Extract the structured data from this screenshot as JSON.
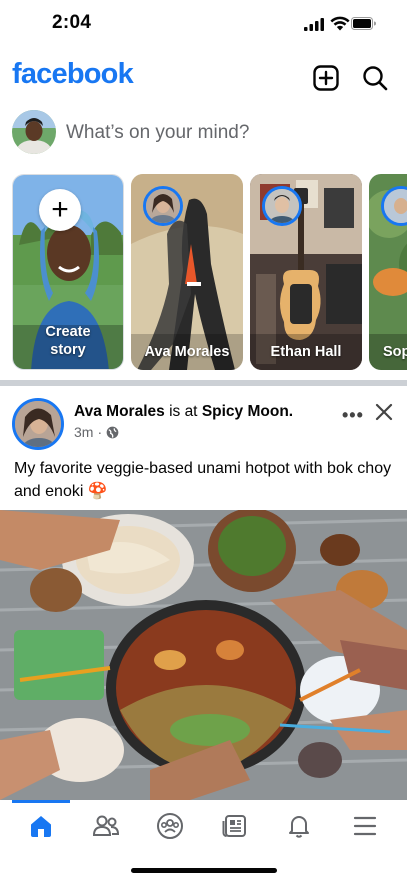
{
  "status": {
    "time": "2:04"
  },
  "header": {
    "logo": "facebook",
    "icons": [
      "plus-square-icon",
      "search-icon"
    ]
  },
  "composer": {
    "placeholder": "What’s on your mind?"
  },
  "stories": [
    {
      "label": "Create story",
      "type": "create"
    },
    {
      "label": "Ava Morales"
    },
    {
      "label": "Ethan Hall"
    },
    {
      "label": "Sop"
    }
  ],
  "post": {
    "author": "Ava Morales",
    "connector": "is at",
    "place": "Spicy Moon.",
    "time": "3m",
    "privacy_icon": "globe-icon",
    "text": "My favorite veggie-based unami hotpot with bok choy and enoki 🍄"
  },
  "tabbar": {
    "tabs": [
      "home-icon",
      "friends-icon",
      "groups-icon",
      "news-feed-icon",
      "notifications-icon",
      "menu-icon"
    ],
    "active": "home-icon"
  },
  "colors": {
    "brand": "#1877f2",
    "secondary_text": "#65676b",
    "divider": "#ccd0d5"
  }
}
